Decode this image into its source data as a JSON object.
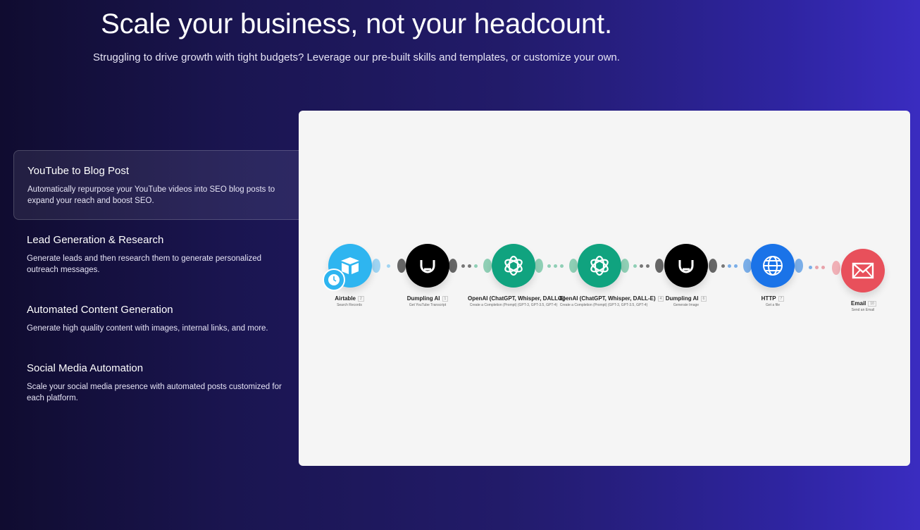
{
  "hero": {
    "title": "Scale your business, not your headcount.",
    "subtitle": "Struggling to drive growth with tight budgets? Leverage our pre-built skills and templates, or customize your own."
  },
  "features": [
    {
      "title": "YouTube to Blog Post",
      "description": "Automatically repurpose your YouTube videos into SEO blog posts to expand your reach and boost SEO.",
      "active": true
    },
    {
      "title": "Lead Generation & Research",
      "description": "Generate leads and then research them to generate personalized outreach messages.",
      "active": false
    },
    {
      "title": "Automated Content Generation",
      "description": "Generate high quality content with images, internal links, and more.",
      "active": false
    },
    {
      "title": "Social Media Automation",
      "description": "Scale your social media presence with automated posts customized for each platform.",
      "active": false
    }
  ],
  "workflow": {
    "nodes": [
      {
        "name": "Airtable",
        "badge": "2",
        "action": "Search Records",
        "icon": "airtable-icon",
        "color": "#2eb5f0"
      },
      {
        "name": "Dumpling AI",
        "badge": "1",
        "action": "Get YouTube Transcript",
        "icon": "dumpling-ai-icon",
        "color": "#000000"
      },
      {
        "name": "OpenAI (ChatGPT, Whisper, DALL-E)",
        "badge": "",
        "action": "Create a Completion (Prompt) (GPT-3, GPT-3.5, GPT-4)",
        "icon": "openai-icon",
        "color": "#10a37f"
      },
      {
        "name": "OpenAI (ChatGPT, Whisper, DALL-E)",
        "badge": "4",
        "action": "Create a Completion (Prompt) (GPT-3, GPT-3.5, GPT-4)",
        "icon": "openai-icon",
        "color": "#10a37f"
      },
      {
        "name": "Dumpling AI",
        "badge": "6",
        "action": "Generate Image",
        "icon": "dumpling-ai-icon",
        "color": "#000000"
      },
      {
        "name": "HTTP",
        "badge": "7",
        "action": "Get a file",
        "icon": "globe-icon",
        "color": "#1a73e8"
      },
      {
        "name": "Email",
        "badge": "10",
        "action": "Send an Email",
        "icon": "envelope-icon",
        "color": "#e8505b"
      }
    ]
  }
}
